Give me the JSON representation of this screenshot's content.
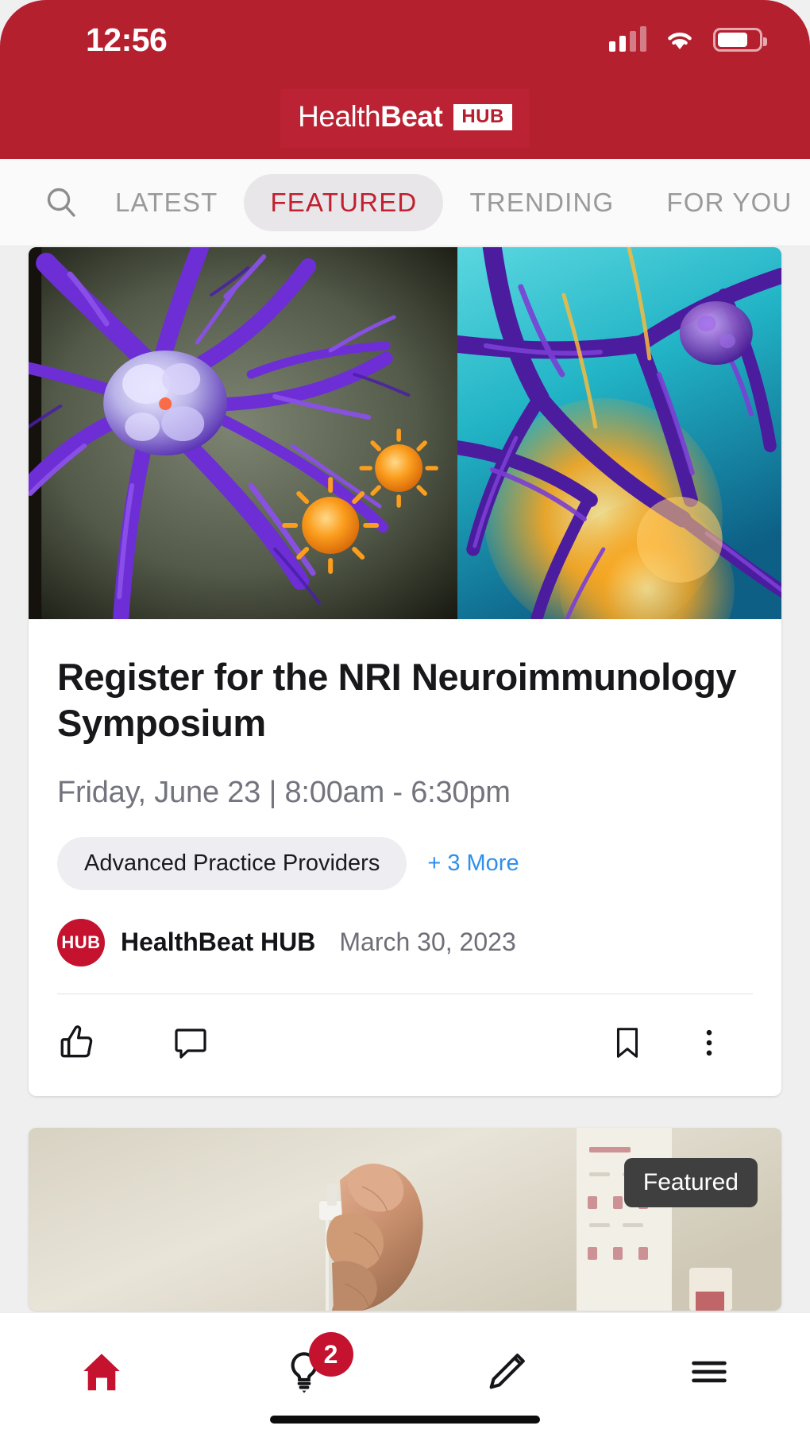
{
  "status_bar": {
    "time": "12:56",
    "signal_icon": "cellular-signal-icon",
    "wifi_icon": "wifi-icon",
    "battery_icon": "battery-icon"
  },
  "header": {
    "logo_light": "Health",
    "logo_bold": "Beat",
    "logo_badge": "HUB",
    "background_color": "#b5202f"
  },
  "tabs": {
    "search_icon": "search-icon",
    "items": [
      {
        "label": "LATEST",
        "active": false
      },
      {
        "label": "FEATURED",
        "active": true
      },
      {
        "label": "TRENDING",
        "active": false
      },
      {
        "label": "FOR YOU",
        "active": false
      }
    ],
    "active_color": "#c0202f",
    "active_pill_color": "#e9e6ea"
  },
  "feed": {
    "cards": [
      {
        "image_alt": "neuron-neuroimmunology-illustration",
        "title": "Register for the NRI Neuroimmunology Symposium",
        "meta": "Friday, June 23  |  8:00am - 6:30pm",
        "chip": "Advanced Practice Providers",
        "more_link": "+ 3 More",
        "avatar_initials": "HUB",
        "author": "HealthBeat HUB",
        "date": "March 30, 2023",
        "actions": {
          "like": "thumbs-up-icon",
          "comment": "comment-icon",
          "bookmark": "bookmark-icon",
          "overflow": "more-vertical-icon"
        }
      },
      {
        "image_alt": "hand-holding-syringe-photo",
        "badge": "Featured"
      }
    ]
  },
  "bottom_nav": {
    "items": [
      {
        "icon": "home-icon",
        "active": true,
        "badge": null
      },
      {
        "icon": "lightbulb-icon",
        "active": false,
        "badge": "2"
      },
      {
        "icon": "pencil-icon",
        "active": false,
        "badge": null
      },
      {
        "icon": "hamburger-menu-icon",
        "active": false,
        "badge": null
      }
    ],
    "active_color": "#c4122f"
  }
}
